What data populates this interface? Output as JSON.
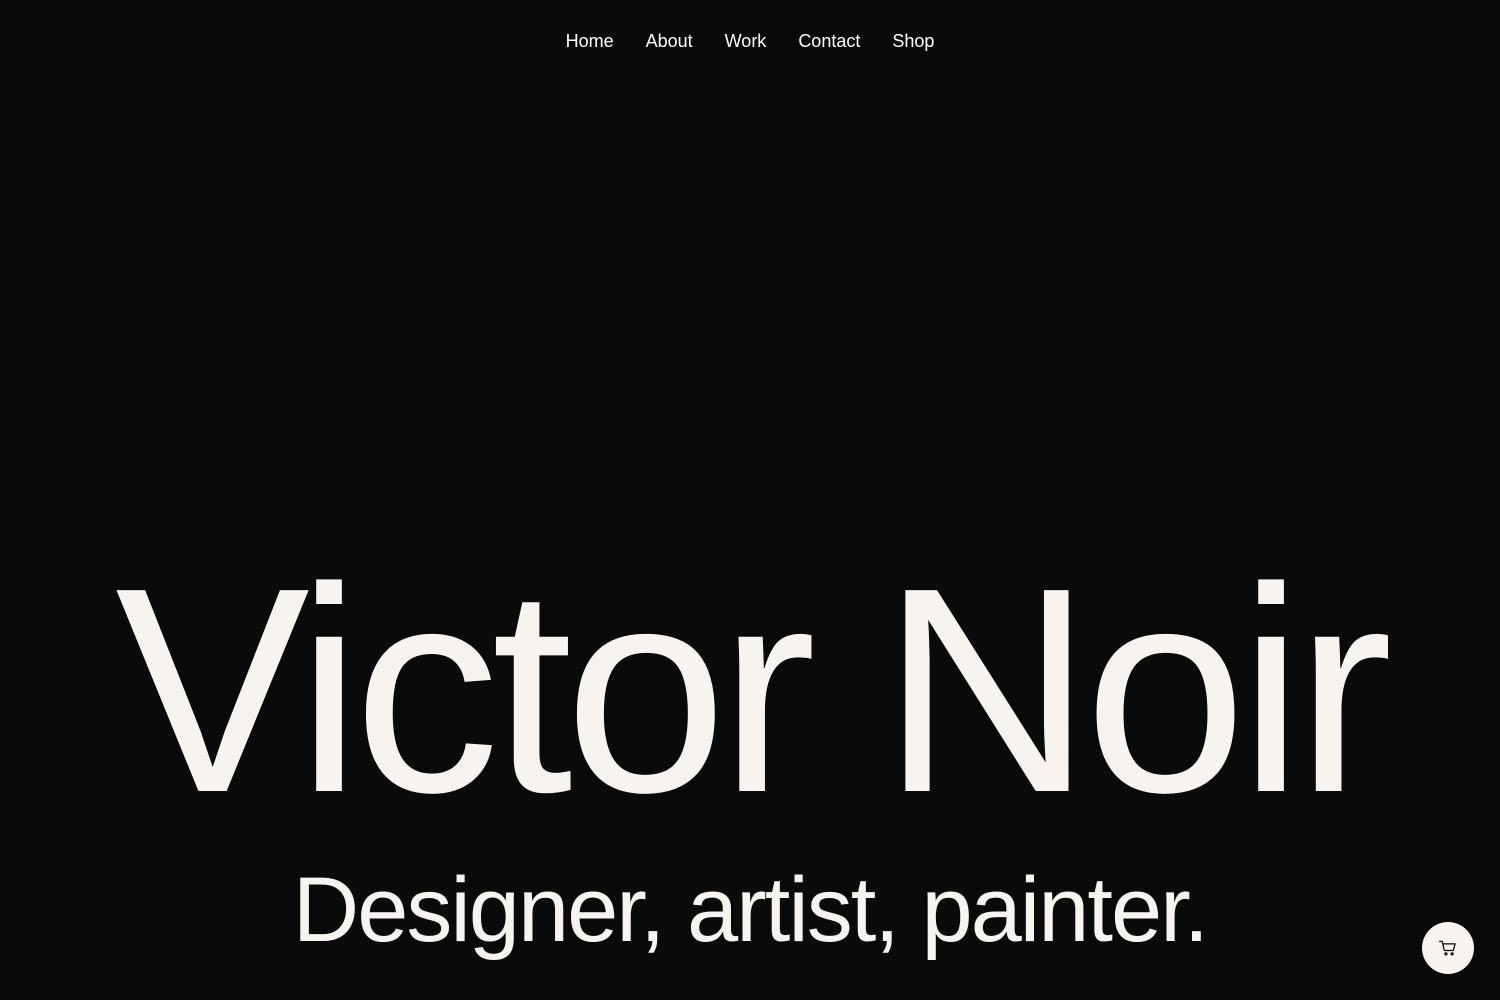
{
  "nav": {
    "items": [
      {
        "label": "Home"
      },
      {
        "label": "About"
      },
      {
        "label": "Work"
      },
      {
        "label": "Contact"
      },
      {
        "label": "Shop"
      }
    ]
  },
  "hero": {
    "name": "Victor Noir",
    "tagline": "Designer, artist, painter."
  },
  "cart": {
    "icon": "shopping-cart-icon"
  },
  "colors": {
    "background": "#0a0a0a",
    "text": "#f7f4ef",
    "cart_button": "#f7f4ef"
  }
}
